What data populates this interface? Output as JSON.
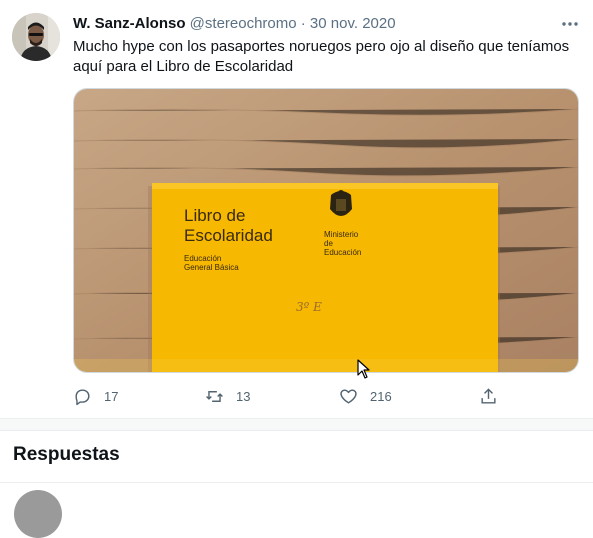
{
  "tweet": {
    "author_name": "W. Sanz-Alonso",
    "handle_date": "@stereochromo · 30 nov. 2020",
    "text": "Mucho hype con los pasaportes noruegos pero ojo al diseño que teníamos aquí para el Libro de Escolaridad",
    "more_icon": "more-horizontal-icon"
  },
  "image": {
    "title_line1": "Libro de",
    "title_line2": "Escolaridad",
    "subtitle_line1": "Educación",
    "subtitle_line2": "General Básica",
    "ministry_line1": "Ministerio",
    "ministry_line2": "de",
    "ministry_line3": "Educación",
    "handwriting": "3º E",
    "book_color": "#f6b800",
    "table_color": "#b89472"
  },
  "actions": {
    "reply_count": "17",
    "retweet_count": "13",
    "like_count": "216"
  },
  "replies": {
    "title": "Respuestas"
  }
}
